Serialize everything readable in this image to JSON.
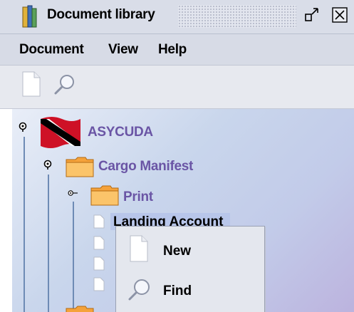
{
  "window": {
    "title": "Document library",
    "restore_icon": "restore-window-icon",
    "close_icon": "close-window-icon"
  },
  "menubar": {
    "items": [
      "Document",
      "View",
      "Help"
    ]
  },
  "toolbar": {
    "buttons": [
      {
        "icon": "new-document-icon"
      },
      {
        "icon": "find-icon"
      }
    ]
  },
  "tree": {
    "root": {
      "label": "ASYCUDA",
      "icon": "trinidad-flag-icon"
    },
    "cargo": {
      "label": "Cargo Manifest",
      "icon": "folder-icon"
    },
    "print": {
      "label": "Print",
      "icon": "folder-icon"
    },
    "selected_item": {
      "label": "Landing Account",
      "icon": "document-icon"
    }
  },
  "context_menu": {
    "items": [
      {
        "label": "New",
        "icon": "new-document-icon"
      },
      {
        "label": "Find",
        "icon": "find-icon"
      }
    ]
  },
  "colors": {
    "tree_label": "#6a55a5",
    "selection": "#b8c6ea",
    "tree_line": "#6e8bb5"
  }
}
